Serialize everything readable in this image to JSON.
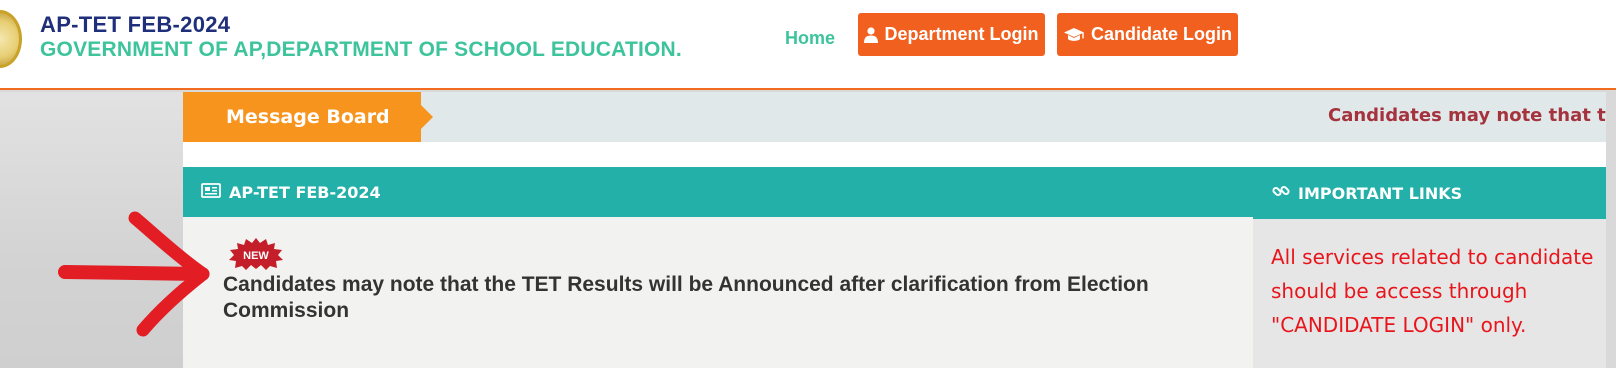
{
  "header": {
    "title": "AP-TET FEB-2024",
    "subtitle": "GOVERNMENT OF AP,DEPARTMENT OF SCHOOL EDUCATION.",
    "nav_home": "Home",
    "department_login": "Department Login",
    "candidate_login": "Candidate Login"
  },
  "message_board": {
    "label": "Message Board",
    "scrolling_text": "Candidates may note that the TET Results will be Announced after clarification from Election Commission"
  },
  "main_panel": {
    "heading": "AP-TET FEB-2024",
    "badge": "NEW",
    "notice": "Candidates may note that the TET Results will be Announced after clarification from Election Commission"
  },
  "side_panel": {
    "heading": "IMPORTANT LINKS",
    "text": "All services related to candidate should be access through \"CANDIDATE LOGIN\" only."
  },
  "colors": {
    "brand_orange": "#f2601f",
    "teal": "#22b0a9",
    "title_navy": "#1f2f7a",
    "subtitle_green": "#3ec49c",
    "alert_red": "#e8161c",
    "marquee_red": "#a4333d",
    "message_label_orange": "#f7941d"
  },
  "icons": {
    "department_login": "user-icon",
    "candidate_login": "graduation-cap-icon",
    "main_heading": "newspaper-icon",
    "side_heading": "link-icon"
  }
}
